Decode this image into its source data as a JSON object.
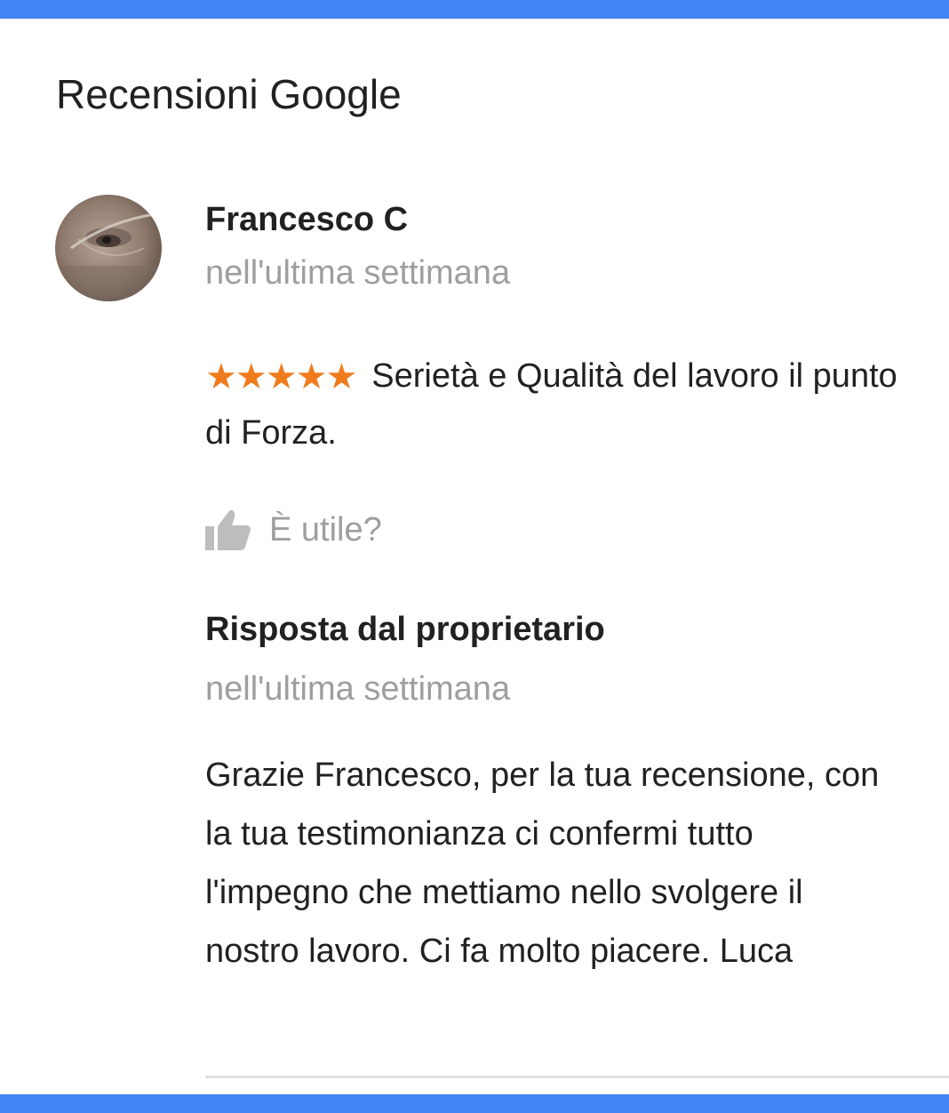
{
  "header": {
    "title": "Recensioni Google"
  },
  "colors": {
    "accent_bar": "#4285f4",
    "star": "#f07b1d",
    "muted_text": "#9e9e9e",
    "text": "#212121"
  },
  "review": {
    "author": "Francesco C",
    "avatar_icon": "user-photo",
    "date": "nell'ultima settimana",
    "rating": 5,
    "stars": "★★★★★",
    "text": "Serietà e Qualità del lavoro il punto di Forza.",
    "helpful_icon": "thumbs-up-icon",
    "helpful_label": "È utile?"
  },
  "owner_response": {
    "title": "Risposta dal proprietario",
    "date": "nell'ultima settimana",
    "text": "Grazie Francesco, per la tua recensione, con la tua testimonianza ci confermi tutto l'impegno che mettiamo nello svolgere il nostro lavoro. Ci fa molto piacere. Luca"
  }
}
